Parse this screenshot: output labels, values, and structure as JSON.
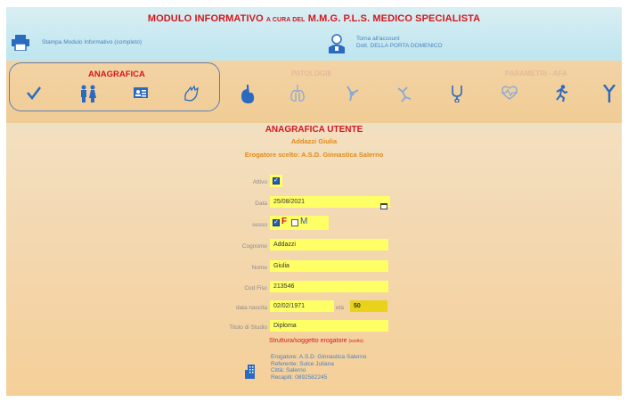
{
  "header": {
    "title_main": "MODULO INFORMATIVO",
    "title_small": "A CURA DEL",
    "title_rest": "M.M.G. P.L.S. MEDICO SPECIALISTA",
    "print_link": "Stampa Modulo Informativo (completo)",
    "account_line1": "Torna all'account",
    "account_line2": "Dott. DELLA PORTA DOMENICO"
  },
  "tabs": {
    "anagrafica": "ANAGRAFICA",
    "patologie": "PATOLOGIE",
    "parametri": "PARAMETRI - AFA"
  },
  "form": {
    "title": "ANAGRAFICA UTENTE",
    "subject_name": "Addazzi Giulia",
    "erogatore_scelto": "Erogatore scelto:  A.S.D. Ginnastica Salerno",
    "labels": {
      "attivo": "Attivo",
      "data": "Data",
      "sesso": "sesso",
      "cognome": "Cognome",
      "nome": "Nome",
      "codfisc": "Cod Fisc",
      "data_nascita": "data nascita",
      "eta": "età",
      "titolo": "Titolo di Studio"
    },
    "values": {
      "data": "25/08/2021",
      "sex_f": "F",
      "sex_m": "M",
      "cognome": "Addazzi",
      "nome": "Giulia",
      "codfisc": "213546",
      "data_nascita": "02/02/1971",
      "eta": "50",
      "titolo": "Diploma"
    },
    "struttura_label": "Struttura/soggetto erogatore",
    "struttura_small": "(scelto)",
    "erogatore_lines": [
      "Erogatore:  A.S.D. Ginnastica Salerno",
      "Referente:  Sulce Juliana",
      "Città:         Salerno",
      "Recapiti:    0892582245"
    ]
  },
  "icons": {
    "print": "printer-icon",
    "account": "doctor-icon",
    "anagrafica_tabs": [
      "check-icon",
      "people-icon",
      "id-card-icon",
      "hand-icon"
    ],
    "patologie_tabs": [
      "stomach-icon",
      "lungs-icon",
      "joint-icon",
      "muscle-icon",
      "stethoscope-icon"
    ],
    "parametri_tabs": [
      "heartbeat-icon",
      "runner-icon",
      "fork-icon"
    ]
  }
}
